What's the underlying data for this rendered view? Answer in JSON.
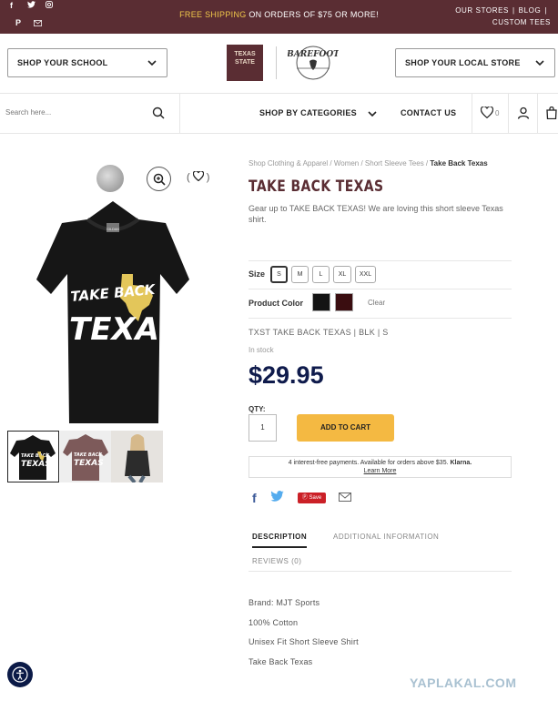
{
  "topbar": {
    "promo_highlight": "FREE SHIPPING",
    "promo_rest": " ON ORDERS OF $75 OR MORE!",
    "link_stores": "OUR STORES",
    "link_blog": "BLOG",
    "link_custom": "CUSTOM TEES",
    "social": [
      "facebook-icon",
      "twitter-icon",
      "instagram-icon",
      "pinterest-icon",
      "email-icon"
    ],
    "bg_color": "#5a2d33",
    "highlight_color": "#f0c84a"
  },
  "header": {
    "school_select": "SHOP YOUR SCHOOL",
    "store_select": "SHOP YOUR LOCAL STORE",
    "logo_left": "TEXAS STATE",
    "logo_right": "BAREFOOT"
  },
  "nav": {
    "search_placeholder": "Search here...",
    "categories": "SHOP BY CATEGORIES",
    "contact": "CONTACT US",
    "wishlist_count": "0"
  },
  "product": {
    "breadcrumb_path": "Shop Clothing & Apparel / Women / Short Sleeve Tees / ",
    "breadcrumb_current": "Take Back Texas",
    "title": "TAKE BACK TEXAS",
    "description": "Gear up to TAKE BACK TEXAS! We are loving this short sleeve Texas shirt.",
    "size_label": "Size",
    "sizes": [
      "S",
      "M",
      "L",
      "XL",
      "XXL"
    ],
    "selected_size": "S",
    "color_label": "Product Color",
    "colors": [
      "#141414",
      "#3a0d10"
    ],
    "clear": "Clear",
    "sku": "TXST TAKE BACK TEXAS | BLK | S",
    "stock": "In stock",
    "price": "$29.95",
    "qty_label": "QTY:",
    "qty_value": "1",
    "add_to_cart": "ADD TO CART",
    "klarna_text": "4 interest-free payments. Available for orders above $35.",
    "klarna_brand": "Klarna.",
    "klarna_link": "Learn More",
    "save_label": "Save",
    "shirt_text_top": "TAKE BACK",
    "shirt_text_bottom": "TEXAS",
    "shirt_tag": "GILDAN"
  },
  "tabs": {
    "description": "DESCRIPTION",
    "additional": "ADDITIONAL INFORMATION",
    "reviews": "REVIEWS (0)"
  },
  "attributes": [
    "Brand: MJT Sports",
    "100% Cotton",
    "Unisex Fit Short Sleeve Shirt",
    "Take Back Texas"
  ],
  "watermark": "YAPLAKAL.COM"
}
